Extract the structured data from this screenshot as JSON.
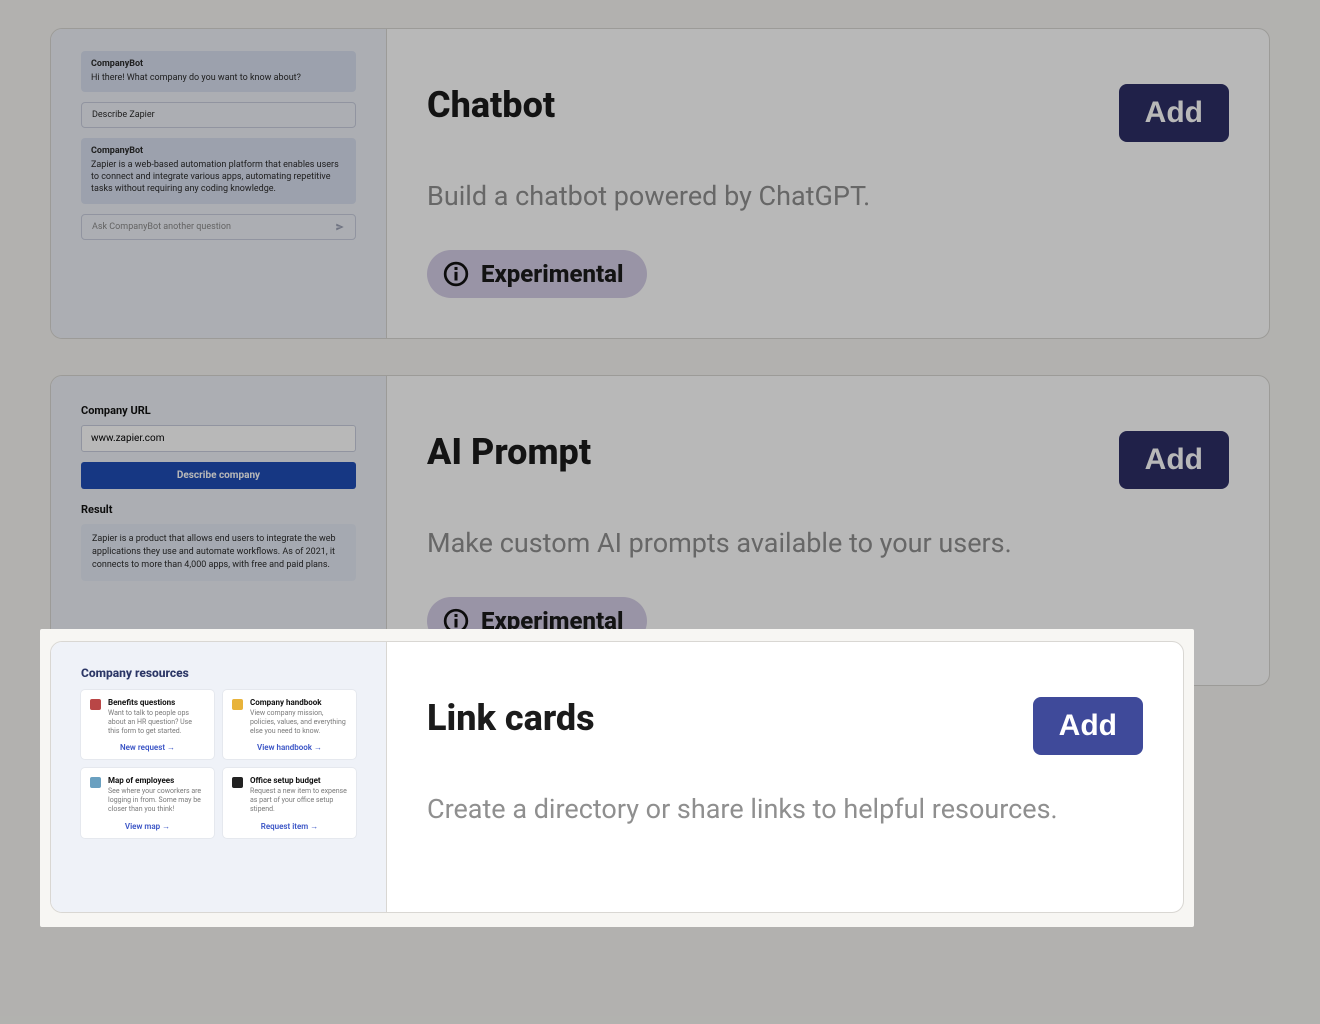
{
  "common": {
    "add_label": "Add",
    "experimental_label": "Experimental"
  },
  "cards": {
    "chatbot": {
      "title": "Chatbot",
      "desc": "Build a chatbot powered by ChatGPT.",
      "thumb": {
        "bot_name": "CompanyBot",
        "greeting": "Hi there! What company do you want to know about?",
        "user_msg": "Describe Zapier",
        "bot_reply": "Zapier is a web-based automation platform that enables users to connect and integrate various apps, automating repetitive tasks without requiring any coding knowledge.",
        "ask_placeholder": "Ask CompanyBot another question"
      }
    },
    "ai_prompt": {
      "title": "AI Prompt",
      "desc": "Make custom AI prompts available to your users.",
      "thumb": {
        "url_label": "Company URL",
        "url_value": "www.zapier.com",
        "button": "Describe company",
        "result_label": "Result",
        "result_text": "Zapier is a product that allows end users to integrate the web applications they use and automate workflows. As of 2021, it connects to more than 4,000 apps, with free and paid plans."
      }
    },
    "link_cards": {
      "title": "Link cards",
      "desc": "Create a directory or share links to helpful resources.",
      "thumb": {
        "heading": "Company resources",
        "items": [
          {
            "title": "Benefits questions",
            "sub": "Want to talk to people ops about an HR question? Use this form to get started.",
            "cta": "New request"
          },
          {
            "title": "Company handbook",
            "sub": "View company mission, policies, values, and everything else you need to know.",
            "cta": "View handbook"
          },
          {
            "title": "Map of employees",
            "sub": "See where your coworkers are logging in from. Some may be closer than you think!",
            "cta": "View map"
          },
          {
            "title": "Office setup budget",
            "sub": "Request a new item to expense as part of your office setup stipend.",
            "cta": "Request item"
          }
        ]
      }
    }
  }
}
